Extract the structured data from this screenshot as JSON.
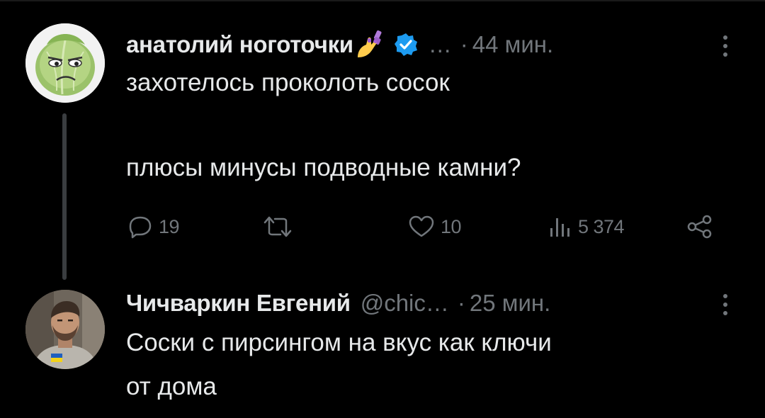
{
  "tweets": [
    {
      "author_name": "анатолий ноготочки",
      "handle": "…",
      "separator": "·",
      "time": "44 мин.",
      "text_line1": "захотелось проколоть сосок",
      "text_line2": "плюсы минусы подводные камни?",
      "avatar_icon": "cabbage-avatar",
      "name_emoji": "nail-polish-emoji",
      "verified_icon": "verified-badge-icon",
      "metrics": {
        "replies": "19",
        "retweets": "",
        "likes": "10",
        "views": "5 374"
      }
    },
    {
      "author_name": "Чичваркин Евгений",
      "handle": "@chic…",
      "separator": "·",
      "time": "25 мин.",
      "text_line1": "Соски с пирсингом на вкус как ключи",
      "text_line2": "от дома",
      "avatar_icon": "user-photo-avatar"
    }
  ],
  "colors": {
    "background": "#000000",
    "text_primary": "#e7e9ea",
    "text_secondary": "#71767b",
    "verified_blue": "#1d9bf0",
    "thread_line": "#3a3d40"
  }
}
